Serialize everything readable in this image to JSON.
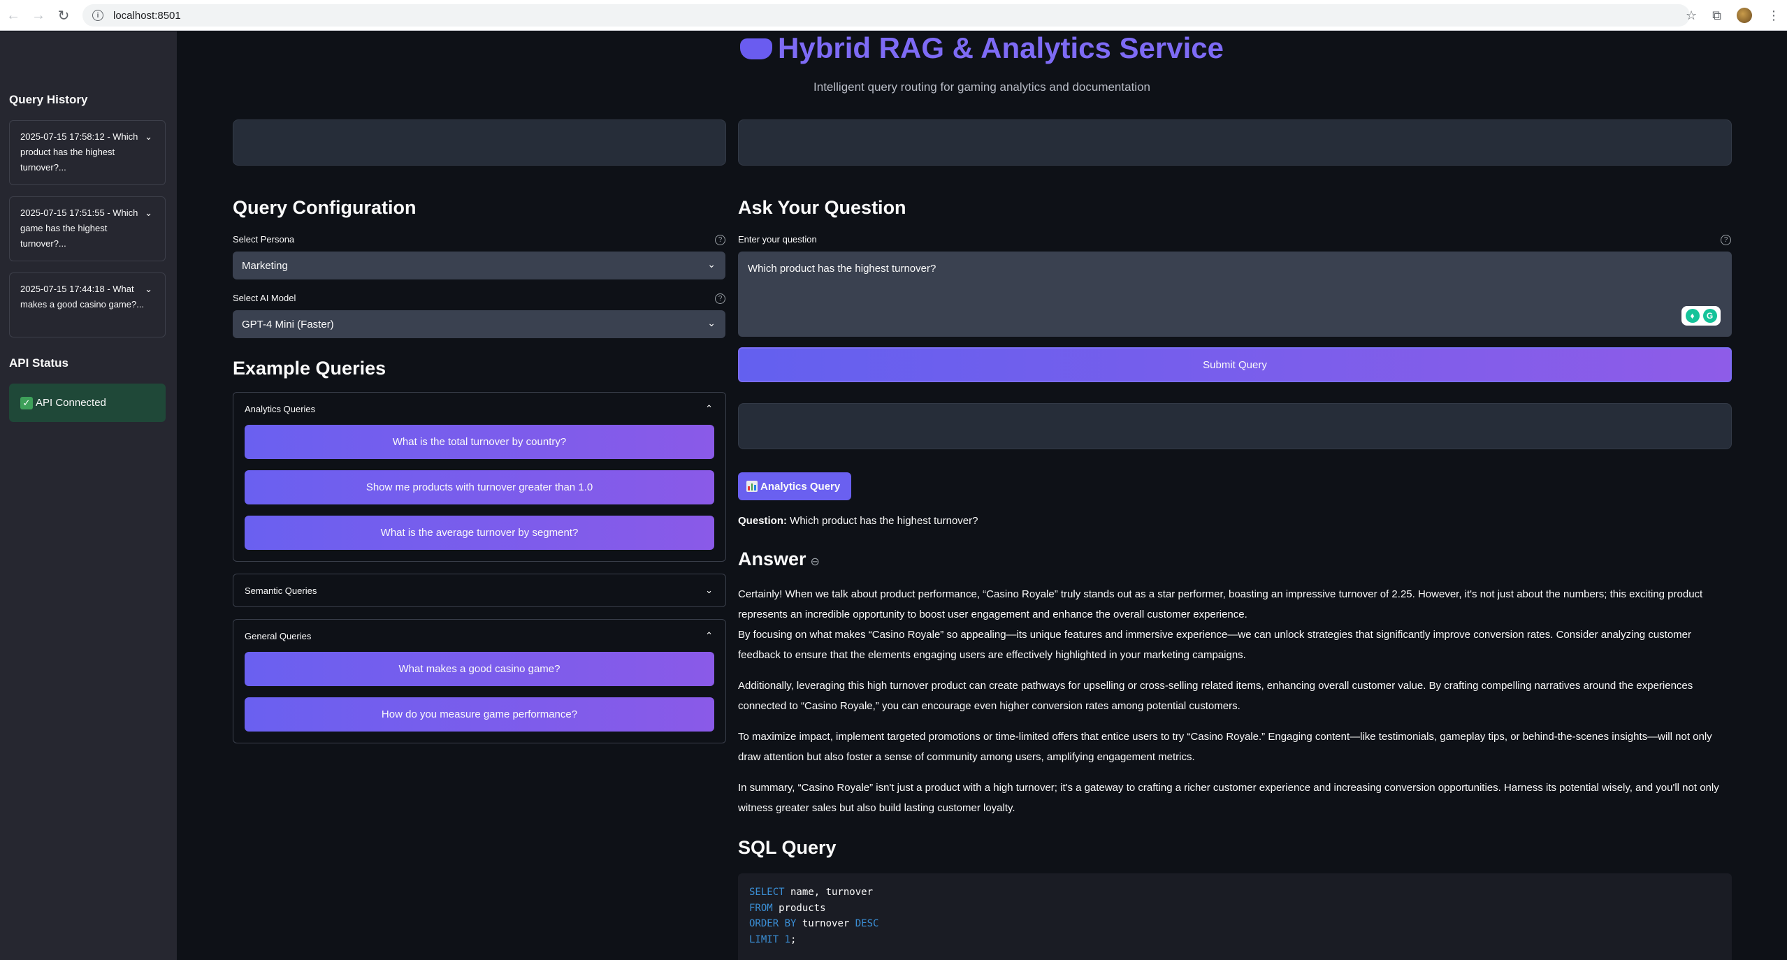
{
  "browser": {
    "url": "localhost:8501"
  },
  "sidebar": {
    "history_title": "Query History",
    "history": [
      {
        "label": "2025-07-15 17:58:12 - Which product has the highest turnover?..."
      },
      {
        "label": "2025-07-15 17:51:55 - Which game has the highest turnover?..."
      },
      {
        "label": "2025-07-15 17:44:18 - What makes a good casino game?..."
      }
    ],
    "api_title": "API Status",
    "api_status": "API Connected"
  },
  "header": {
    "title": "Hybrid RAG & Analytics Service",
    "subtitle": "Intelligent query routing for gaming analytics and documentation"
  },
  "config": {
    "heading": "Query Configuration",
    "persona_label": "Select Persona",
    "persona_value": "Marketing",
    "model_label": "Select AI Model",
    "model_value": "GPT-4 Mini (Faster)"
  },
  "examples": {
    "heading": "Example Queries",
    "analytics_title": "Analytics Queries",
    "analytics": [
      "What is the total turnover by country?",
      "Show me products with turnover greater than 1.0",
      "What is the average turnover by segment?"
    ],
    "semantic_title": "Semantic Queries",
    "general_title": "General Queries",
    "general": [
      "What makes a good casino game?",
      "How do you measure game performance?"
    ]
  },
  "ask": {
    "heading": "Ask Your Question",
    "input_label": "Enter your question",
    "input_value": "Which product has the highest turnover?",
    "submit_label": "Submit Query"
  },
  "result": {
    "badge": "Analytics Query",
    "question_label": "Question:",
    "question_text": "Which product has the highest turnover?",
    "answer_heading": "Answer",
    "paragraphs": [
      "Certainly! When we talk about product performance, “Casino Royale” truly stands out as a star performer, boasting an impressive turnover of 2.25. However, it's not just about the numbers; this exciting product represents an incredible opportunity to boost user engagement and enhance the overall customer experience.",
      "By focusing on what makes “Casino Royale” so appealing—its unique features and immersive experience—we can unlock strategies that significantly improve conversion rates. Consider analyzing customer feedback to ensure that the elements engaging users are effectively highlighted in your marketing campaigns.",
      "Additionally, leveraging this high turnover product can create pathways for upselling or cross-selling related items, enhancing overall customer value. By crafting compelling narratives around the experiences connected to “Casino Royale,” you can encourage even higher conversion rates among potential customers.",
      "To maximize impact, implement targeted promotions or time-limited offers that entice users to try “Casino Royale.” Engaging content—like testimonials, gameplay tips, or behind-the-scenes insights—will not only draw attention but also foster a sense of community among users, amplifying engagement metrics.",
      "In summary, “Casino Royale” isn't just a product with a high turnover; it's a gateway to crafting a richer customer experience and increasing conversion opportunities. Harness its potential wisely, and you'll not only witness greater sales but also build lasting customer loyalty."
    ],
    "sql_heading": "SQL Query",
    "sql": {
      "l1_kw": "SELECT",
      "l1_rest": " name, turnover",
      "l2_kw": "FROM",
      "l2_rest": " products",
      "l3_kw": "ORDER BY",
      "l3_mid": " turnover ",
      "l3_kw2": "DESC",
      "l4_kw": "LIMIT",
      "l4_num": " 1",
      "l4_end": ";"
    }
  }
}
